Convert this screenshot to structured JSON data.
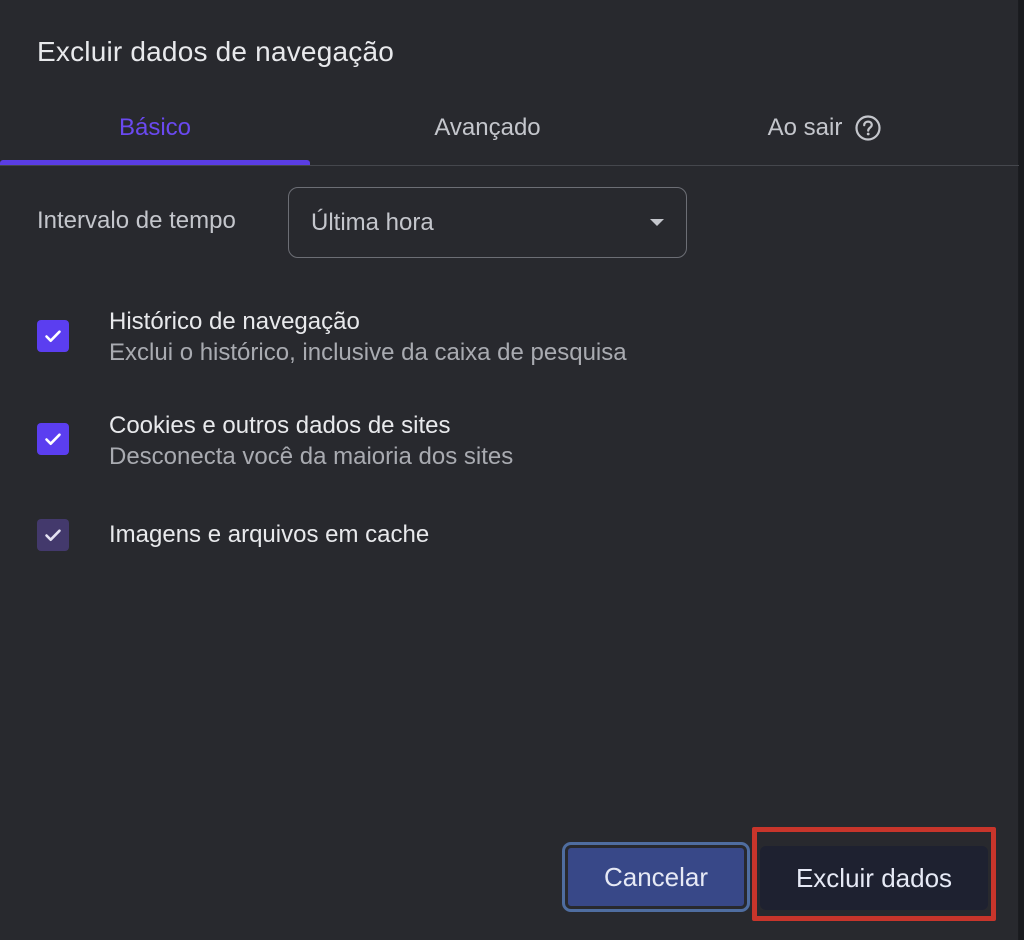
{
  "dialog": {
    "title": "Excluir dados de navegação"
  },
  "tabs": [
    {
      "label": "Básico",
      "active": true
    },
    {
      "label": "Avançado",
      "active": false
    },
    {
      "label": "Ao sair",
      "active": false,
      "icon": "help-circle-icon"
    }
  ],
  "time_range": {
    "label": "Intervalo de tempo",
    "value": "Última hora"
  },
  "options": [
    {
      "title": "Histórico de navegação",
      "subtitle": "Exclui o histórico, inclusive da caixa de pesquisa",
      "checked": true
    },
    {
      "title": "Cookies e outros dados de sites",
      "subtitle": "Desconecta você da maioria dos sites",
      "checked": true
    },
    {
      "title": "Imagens e arquivos em cache",
      "checked": true
    }
  ],
  "buttons": {
    "cancel": "Cancelar",
    "delete": "Excluir dados"
  },
  "colors": {
    "accent": "#5b3ef0",
    "highlight": "#c8352b",
    "background": "#28292e"
  }
}
